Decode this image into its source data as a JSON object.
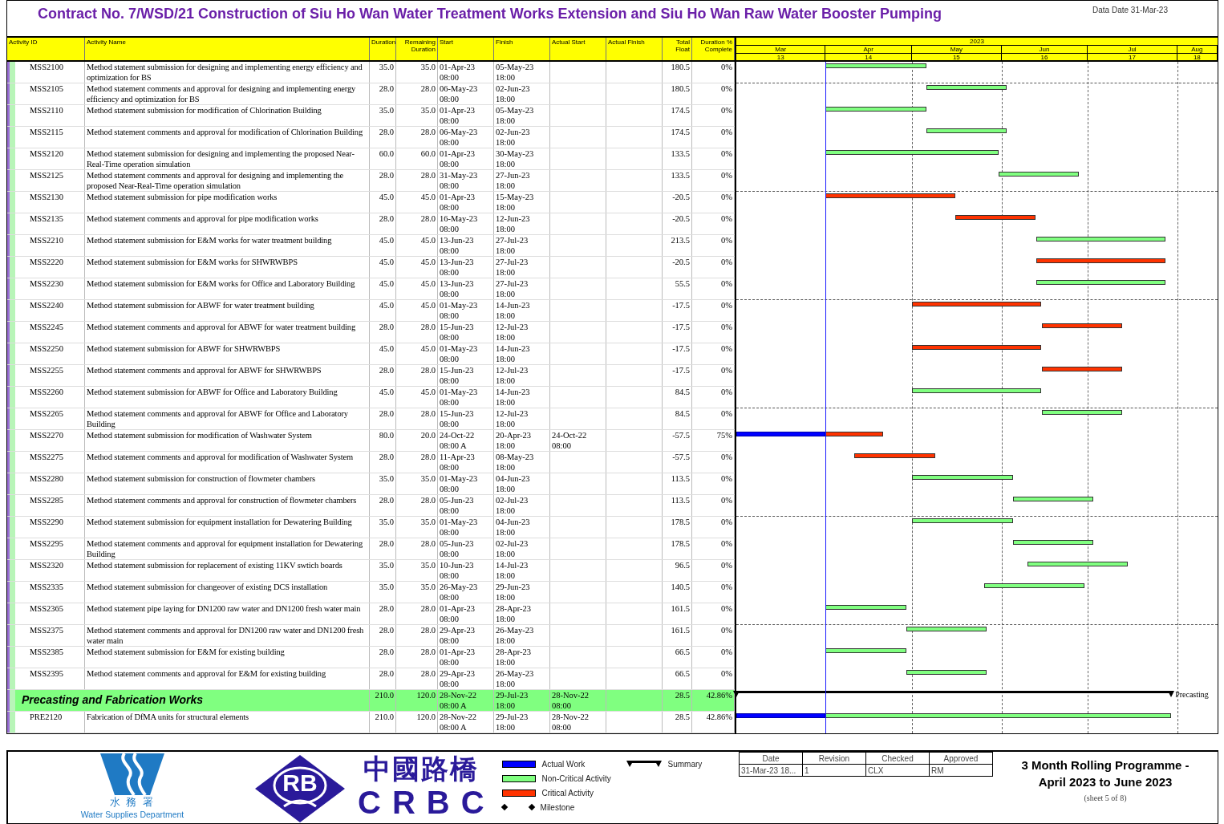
{
  "title": "Contract No. 7/WSD/21 Construction of Siu Ho Wan Water Treatment Works Extension and Siu Ho Wan Raw Water Booster Pumping",
  "data_date": "Data Date 31-Mar-23",
  "columns": [
    "Activity ID",
    "Activity Name",
    "Duration",
    "Remaining Duration",
    "Start",
    "Finish",
    "Actual Start",
    "Actual Finish",
    "Total Float",
    "Duration % Complete"
  ],
  "timescale": {
    "year": "2023",
    "months": [
      {
        "label": "Mar",
        "number": "13"
      },
      {
        "label": "Apr",
        "number": "14"
      },
      {
        "label": "May",
        "number": "15"
      },
      {
        "label": "Jun",
        "number": "16"
      },
      {
        "label": "Jul",
        "number": "17"
      },
      {
        "label": "Aug",
        "number": "18"
      }
    ]
  },
  "rows": [
    {
      "kind": "noncritical",
      "activity_id": "MSS2100",
      "name": "Method statement submission for designing and implementing energy efficiency and optimization for BS",
      "duration": "35.0",
      "remaining": "35.0",
      "start": "01-Apr-23",
      "start_time": "08:00",
      "finish": "05-May-23",
      "finish_time": "18:00",
      "total_float": "180.5",
      "complete": "0%"
    },
    {
      "kind": "noncritical",
      "activity_id": "MSS2105",
      "name": "Method statement comments and approval for designing and implementing energy efficiency and optimization for BS",
      "duration": "28.0",
      "remaining": "28.0",
      "start": "06-May-23",
      "start_time": "08:00",
      "finish": "02-Jun-23",
      "finish_time": "18:00",
      "total_float": "180.5",
      "complete": "0%"
    },
    {
      "kind": "noncritical",
      "activity_id": "MSS2110",
      "name": "Method statement submission for modification of Chlorination Building",
      "duration": "35.0",
      "remaining": "35.0",
      "start": "01-Apr-23",
      "start_time": "08:00",
      "finish": "05-May-23",
      "finish_time": "18:00",
      "total_float": "174.5",
      "complete": "0%"
    },
    {
      "kind": "noncritical",
      "activity_id": "MSS2115",
      "name": "Method statement comments and approval for modification of Chlorination Building",
      "duration": "28.0",
      "remaining": "28.0",
      "start": "06-May-23",
      "start_time": "08:00",
      "finish": "02-Jun-23",
      "finish_time": "18:00",
      "total_float": "174.5",
      "complete": "0%"
    },
    {
      "kind": "noncritical",
      "activity_id": "MSS2120",
      "name": "Method statement submission for designing and implementing the proposed Near-Real-Time operation simulation",
      "duration": "60.0",
      "remaining": "60.0",
      "start": "01-Apr-23",
      "start_time": "08:00",
      "finish": "30-May-23",
      "finish_time": "18:00",
      "total_float": "133.5",
      "complete": "0%"
    },
    {
      "kind": "noncritical",
      "activity_id": "MSS2125",
      "name": "Method statement comments and approval for designing and implementing the proposed Near-Real-Time operation simulation",
      "duration": "28.0",
      "remaining": "28.0",
      "start": "31-May-23",
      "start_time": "08:00",
      "finish": "27-Jun-23",
      "finish_time": "18:00",
      "total_float": "133.5",
      "complete": "0%"
    },
    {
      "kind": "critical",
      "activity_id": "MSS2130",
      "name": "Method statement submission for pipe modification works",
      "duration": "45.0",
      "remaining": "45.0",
      "start": "01-Apr-23",
      "start_time": "08:00",
      "finish": "15-May-23",
      "finish_time": "18:00",
      "total_float": "-20.5",
      "complete": "0%"
    },
    {
      "kind": "critical",
      "activity_id": "MSS2135",
      "name": "Method statement comments and approval for pipe modification works",
      "duration": "28.0",
      "remaining": "28.0",
      "start": "16-May-23",
      "start_time": "08:00",
      "finish": "12-Jun-23",
      "finish_time": "18:00",
      "total_float": "-20.5",
      "complete": "0%"
    },
    {
      "kind": "noncritical",
      "activity_id": "MSS2210",
      "name": "Method statement submission for E&M works for water treatment building",
      "duration": "45.0",
      "remaining": "45.0",
      "start": "13-Jun-23",
      "start_time": "08:00",
      "finish": "27-Jul-23",
      "finish_time": "18:00",
      "total_float": "213.5",
      "complete": "0%"
    },
    {
      "kind": "critical",
      "activity_id": "MSS2220",
      "name": "Method statement submission for E&M works for SHWRWBPS",
      "duration": "45.0",
      "remaining": "45.0",
      "start": "13-Jun-23",
      "start_time": "08:00",
      "finish": "27-Jul-23",
      "finish_time": "18:00",
      "total_float": "-20.5",
      "complete": "0%"
    },
    {
      "kind": "noncritical",
      "activity_id": "MSS2230",
      "name": "Method statement submission for E&M works for Office and Laboratory Building",
      "duration": "45.0",
      "remaining": "45.0",
      "start": "13-Jun-23",
      "start_time": "08:00",
      "finish": "27-Jul-23",
      "finish_time": "18:00",
      "total_float": "55.5",
      "complete": "0%"
    },
    {
      "kind": "critical",
      "activity_id": "MSS2240",
      "name": "Method statement submission for ABWF for water treatment building",
      "duration": "45.0",
      "remaining": "45.0",
      "start": "01-May-23",
      "start_time": "08:00",
      "finish": "14-Jun-23",
      "finish_time": "18:00",
      "total_float": "-17.5",
      "complete": "0%"
    },
    {
      "kind": "critical",
      "activity_id": "MSS2245",
      "name": "Method statement comments and approval for ABWF for water treatment building",
      "duration": "28.0",
      "remaining": "28.0",
      "start": "15-Jun-23",
      "start_time": "08:00",
      "finish": "12-Jul-23",
      "finish_time": "18:00",
      "total_float": "-17.5",
      "complete": "0%"
    },
    {
      "kind": "critical",
      "activity_id": "MSS2250",
      "name": "Method statement submission for ABWF for SHWRWBPS",
      "duration": "45.0",
      "remaining": "45.0",
      "start": "01-May-23",
      "start_time": "08:00",
      "finish": "14-Jun-23",
      "finish_time": "18:00",
      "total_float": "-17.5",
      "complete": "0%"
    },
    {
      "kind": "critical",
      "activity_id": "MSS2255",
      "name": "Method statement comments and approval for ABWF for SHWRWBPS",
      "duration": "28.0",
      "remaining": "28.0",
      "start": "15-Jun-23",
      "start_time": "08:00",
      "finish": "12-Jul-23",
      "finish_time": "18:00",
      "total_float": "-17.5",
      "complete": "0%"
    },
    {
      "kind": "noncritical",
      "activity_id": "MSS2260",
      "name": "Method statement submission for ABWF for Office and Laboratory Building",
      "duration": "45.0",
      "remaining": "45.0",
      "start": "01-May-23",
      "start_time": "08:00",
      "finish": "14-Jun-23",
      "finish_time": "18:00",
      "total_float": "84.5",
      "complete": "0%"
    },
    {
      "kind": "noncritical",
      "activity_id": "MSS2265",
      "name": "Method statement comments and approval for ABWF for Office and Laboratory Building",
      "duration": "28.0",
      "remaining": "28.0",
      "start": "15-Jun-23",
      "start_time": "08:00",
      "finish": "12-Jul-23",
      "finish_time": "18:00",
      "total_float": "84.5",
      "complete": "0%"
    },
    {
      "kind": "critical",
      "activity_id": "MSS2270",
      "name": "Method statement submission for modification of Washwater System",
      "duration": "80.0",
      "remaining": "20.0",
      "start": "24-Oct-22",
      "start_time": "08:00 A",
      "finish": "20-Apr-23",
      "finish_time": "18:00",
      "actual_start": "24-Oct-22",
      "actual_start_time": "08:00",
      "total_float": "-57.5",
      "complete": "75%"
    },
    {
      "kind": "critical",
      "activity_id": "MSS2275",
      "name": "Method statement comments and approval for modification of Washwater System",
      "duration": "28.0",
      "remaining": "28.0",
      "start": "11-Apr-23",
      "start_time": "08:00",
      "finish": "08-May-23",
      "finish_time": "18:00",
      "total_float": "-57.5",
      "complete": "0%"
    },
    {
      "kind": "noncritical",
      "activity_id": "MSS2280",
      "name": "Method statement submission for construction of flowmeter chambers",
      "duration": "35.0",
      "remaining": "35.0",
      "start": "01-May-23",
      "start_time": "08:00",
      "finish": "04-Jun-23",
      "finish_time": "18:00",
      "total_float": "113.5",
      "complete": "0%"
    },
    {
      "kind": "noncritical",
      "activity_id": "MSS2285",
      "name": "Method statement comments and approval for construction of flowmeter chambers",
      "duration": "28.0",
      "remaining": "28.0",
      "start": "05-Jun-23",
      "start_time": "08:00",
      "finish": "02-Jul-23",
      "finish_time": "18:00",
      "total_float": "113.5",
      "complete": "0%"
    },
    {
      "kind": "noncritical",
      "activity_id": "MSS2290",
      "name": "Method statement submission for equipment installation for Dewatering Building",
      "duration": "35.0",
      "remaining": "35.0",
      "start": "01-May-23",
      "start_time": "08:00",
      "finish": "04-Jun-23",
      "finish_time": "18:00",
      "total_float": "178.5",
      "complete": "0%"
    },
    {
      "kind": "noncritical",
      "activity_id": "MSS2295",
      "name": "Method statement comments and approval for equipment installation for Dewatering Building",
      "duration": "28.0",
      "remaining": "28.0",
      "start": "05-Jun-23",
      "start_time": "08:00",
      "finish": "02-Jul-23",
      "finish_time": "18:00",
      "total_float": "178.5",
      "complete": "0%"
    },
    {
      "kind": "noncritical",
      "activity_id": "MSS2320",
      "name": "Method statement submission for replacement of existing 11KV swtich boards",
      "duration": "35.0",
      "remaining": "35.0",
      "start": "10-Jun-23",
      "start_time": "08:00",
      "finish": "14-Jul-23",
      "finish_time": "18:00",
      "total_float": "96.5",
      "complete": "0%"
    },
    {
      "kind": "noncritical",
      "activity_id": "MSS2335",
      "name": "Method statement submission for changeover of existing DCS installation",
      "duration": "35.0",
      "remaining": "35.0",
      "start": "26-May-23",
      "start_time": "08:00",
      "finish": "29-Jun-23",
      "finish_time": "18:00",
      "total_float": "140.5",
      "complete": "0%"
    },
    {
      "kind": "noncritical",
      "activity_id": "MSS2365",
      "name": "Method statement pipe laying for DN1200 raw water and DN1200 fresh water main",
      "duration": "28.0",
      "remaining": "28.0",
      "start": "01-Apr-23",
      "start_time": "08:00",
      "finish": "28-Apr-23",
      "finish_time": "18:00",
      "total_float": "161.5",
      "complete": "0%"
    },
    {
      "kind": "noncritical",
      "activity_id": "MSS2375",
      "name": "Method statement comments and approval for DN1200 raw water and DN1200 fresh water main",
      "duration": "28.0",
      "remaining": "28.0",
      "start": "29-Apr-23",
      "start_time": "08:00",
      "finish": "26-May-23",
      "finish_time": "18:00",
      "total_float": "161.5",
      "complete": "0%"
    },
    {
      "kind": "noncritical",
      "activity_id": "MSS2385",
      "name": "Method statement submission for E&M for existing building",
      "duration": "28.0",
      "remaining": "28.0",
      "start": "01-Apr-23",
      "start_time": "08:00",
      "finish": "28-Apr-23",
      "finish_time": "18:00",
      "total_float": "66.5",
      "complete": "0%"
    },
    {
      "kind": "noncritical",
      "activity_id": "MSS2395",
      "name": "Method statement comments and approval for E&M for existing building",
      "duration": "28.0",
      "remaining": "28.0",
      "start": "29-Apr-23",
      "start_time": "08:00",
      "finish": "26-May-23",
      "finish_time": "18:00",
      "total_float": "66.5",
      "complete": "0%"
    },
    {
      "kind": "summary",
      "name": "Precasting and Fabrication Works",
      "duration": "210.0",
      "remaining": "120.0",
      "start": "28-Nov-22",
      "start_time": "08:00 A",
      "finish": "29-Jul-23",
      "finish_time": "18:00",
      "actual_start": "28-Nov-22",
      "actual_start_time": "08:00",
      "total_float": "28.5",
      "complete": "42.86%",
      "bar_label": "Precasting"
    },
    {
      "kind": "noncritical",
      "activity_id": "PRE2120",
      "name": "Fabrication of DfMA units for structural elements",
      "duration": "210.0",
      "remaining": "120.0",
      "start": "28-Nov-22",
      "start_time": "08:00 A",
      "finish": "29-Jul-23",
      "finish_time": "18:00",
      "actual_start": "28-Nov-22",
      "actual_start_time": "08:00",
      "total_float": "28.5",
      "complete": "42.86%"
    }
  ],
  "footer": {
    "wsd_name_zh": "水 務 署",
    "wsd_name_en": "Water Supplies Department",
    "rb_logo_text": "RB",
    "crbc_name_zh": "中國路橋",
    "crbc_name_en": "CRBC",
    "legend": [
      {
        "kind": "actual",
        "label": "Actual Work"
      },
      {
        "kind": "noncritical",
        "label": "Non-Critical Activity"
      },
      {
        "kind": "critical",
        "label": "Critical Activity"
      },
      {
        "kind": "milestone",
        "label": "Milestone"
      },
      {
        "kind": "summary",
        "label": "Summary"
      }
    ],
    "revision_table": {
      "columns": [
        "Date",
        "Revision",
        "Checked",
        "Approved"
      ],
      "row": [
        "31-Mar-23 18...",
        "1",
        "CLX",
        "RM"
      ]
    },
    "title_lines": [
      "3 Month Rolling Programme -",
      "April 2023 to June 2023"
    ],
    "sheet": "(sheet 5 of 8)"
  }
}
